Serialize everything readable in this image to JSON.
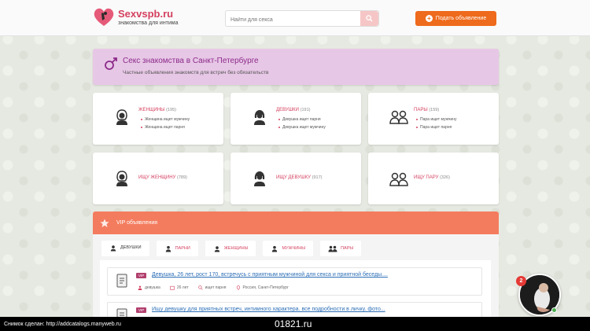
{
  "header": {
    "logo_title": "Sexvspb.ru",
    "logo_subtitle": "знакомства для интима",
    "search_placeholder": "Найти для секса",
    "post_button": "Подать объявление"
  },
  "banner": {
    "title": "Секс знакомства в Санкт-Петербурге",
    "subtitle": "Частные объявления знакомств для встреч без обязательств"
  },
  "categories": [
    {
      "title": "ЖЕНЩИНЫ",
      "count": "(195)",
      "items": [
        "Женщина ищет мужчину",
        "Женщина ищет парня"
      ]
    },
    {
      "title": "ДЕВУШКИ",
      "count": "(191)",
      "items": [
        "Девушка ищет парня",
        "Девушка ищет мужчину"
      ]
    },
    {
      "title": "ПАРЫ",
      "count": "(159)",
      "items": [
        "Пара ищет мужчину",
        "Пара ищет парня"
      ]
    },
    {
      "title": "ИЩУ ЖЕНЩИНУ",
      "count": "(789)"
    },
    {
      "title": "ИЩУ ДЕВУШКУ",
      "count": "(917)"
    },
    {
      "title": "ИЩУ ПАРУ",
      "count": "(326)"
    }
  ],
  "vip": {
    "heading": "VIP объявления",
    "tabs": [
      "ДЕВУШКИ",
      "ПАРНИ",
      "ЖЕНЩИНЫ",
      "МУЖЧИНЫ",
      "ПАРЫ"
    ],
    "ads": [
      {
        "tag": "VIP",
        "title": "Девушка, 26 лет, рост 170, встречусь с приятным мужчиной для секса и приятной беседы....",
        "who": "девушка",
        "age": "26 лет",
        "seeking": "ищет парня",
        "location": "Россия, Санкт-Петербург"
      },
      {
        "tag": "VIP",
        "title": "Ищу девушку для приятных встреч, интимного характера. все подробности в личку. фото..."
      }
    ]
  },
  "chat": {
    "badge": "2"
  },
  "footer": {
    "left": "Снимок сделан: http://addcatalogs.manyweb.ru",
    "center": "01821.ru"
  },
  "colors": {
    "brand": "#d4405f",
    "accent": "#ee6a1c",
    "vip": "#f47c5e",
    "banner": "#e7c7e6"
  }
}
